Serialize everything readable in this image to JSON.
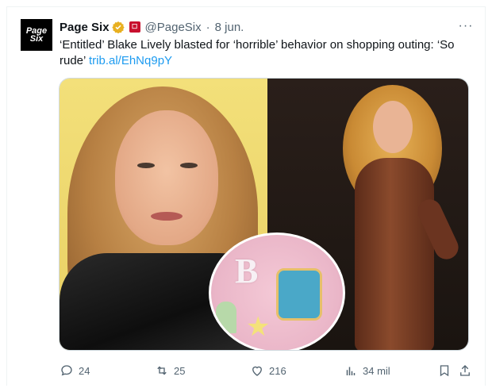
{
  "tweet": {
    "author": {
      "name": "Page Six",
      "handle": "@PageSix",
      "date": "8 jun.",
      "separator": "·",
      "avatar_text_line1": "Page",
      "avatar_text_line2": "Six"
    },
    "text": "‘Entitled’ Blake Lively blasted for ‘horrible’ behavior on shopping outing: ‘So rude’",
    "link": "trib.al/EhNq9pY",
    "more_label": "···",
    "actions": {
      "replies": "24",
      "reposts": "25",
      "likes": "216",
      "views": "34 mil"
    }
  },
  "colors": {
    "text": "#0f1419",
    "muted": "#536471",
    "link": "#1d9bf0",
    "verified": "#e8b021",
    "affiliate": "#c8102e"
  },
  "icons": [
    "verified-badge-icon",
    "affiliate-badge-icon",
    "more-icon",
    "reply-icon",
    "repost-icon",
    "like-icon",
    "views-icon",
    "bookmark-icon",
    "share-icon"
  ]
}
